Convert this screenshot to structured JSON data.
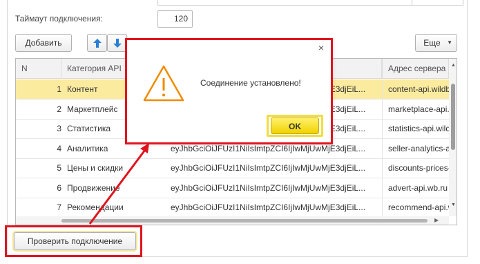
{
  "form": {
    "timeout_label": "Таймаут подключения:",
    "timeout_value": "120"
  },
  "toolbar": {
    "add_label": "Добавить",
    "more_label": "Еще",
    "move_up_icon": "arrow-up-icon",
    "move_down_icon": "arrow-down-icon"
  },
  "table": {
    "columns": [
      "N",
      "Категория API",
      "Адрес сервера"
    ],
    "rows": [
      {
        "n": "1",
        "category": "Контент",
        "token": "eyJhbGciOiJFUzI1NiIsImtpZCI6IjIwMjUwMjE3djEiL...",
        "address": "content-api.wildberries.ru",
        "selected": true
      },
      {
        "n": "2",
        "category": "Маркетплейс",
        "token": "eyJhbGciOiJFUzI1NiIsImtpZCI6IjIwMjUwMjE3djEiL...",
        "address": "marketplace-api.wildberries.ru",
        "selected": false
      },
      {
        "n": "3",
        "category": "Статистика",
        "token": "eyJhbGciOiJFUzI1NiIsImtpZCI6IjIwMjUwMjE3djEiL...",
        "address": "statistics-api.wildberries.ru",
        "selected": false
      },
      {
        "n": "4",
        "category": "Аналитика",
        "token": "eyJhbGciOiJFUzI1NiIsImtpZCI6IjIwMjUwMjE3djEiL...",
        "address": "seller-analytics-api.wildberries.ru",
        "selected": false
      },
      {
        "n": "5",
        "category": "Цены и скидки",
        "token": "eyJhbGciOiJFUzI1NiIsImtpZCI6IjIwMjUwMjE3djEiL...",
        "address": "discounts-prices-api.wildberries.ru",
        "selected": false
      },
      {
        "n": "6",
        "category": "Продвижение",
        "token": "eyJhbGciOiJFUzI1NiIsImtpZCI6IjIwMjUwMjE3djEiL...",
        "address": "advert-api.wb.ru",
        "selected": false
      },
      {
        "n": "7",
        "category": "Рекомендации",
        "token": "eyJhbGciOiJFUzI1NiIsImtpZCI6IjIwMjUwMjE3djEiL...",
        "address": "recommend-api.wildberries.ru",
        "selected": false
      }
    ]
  },
  "footer": {
    "check_label": "Проверить подключение"
  },
  "dialog": {
    "message": "Соединение установлено!",
    "ok_label": "OK",
    "icon": "warning-icon"
  },
  "colors": {
    "highlight_red": "#e0141e",
    "selected_row": "#fbeb9e",
    "ok_button": "#f0d300",
    "warning_orange": "#f08a00"
  }
}
